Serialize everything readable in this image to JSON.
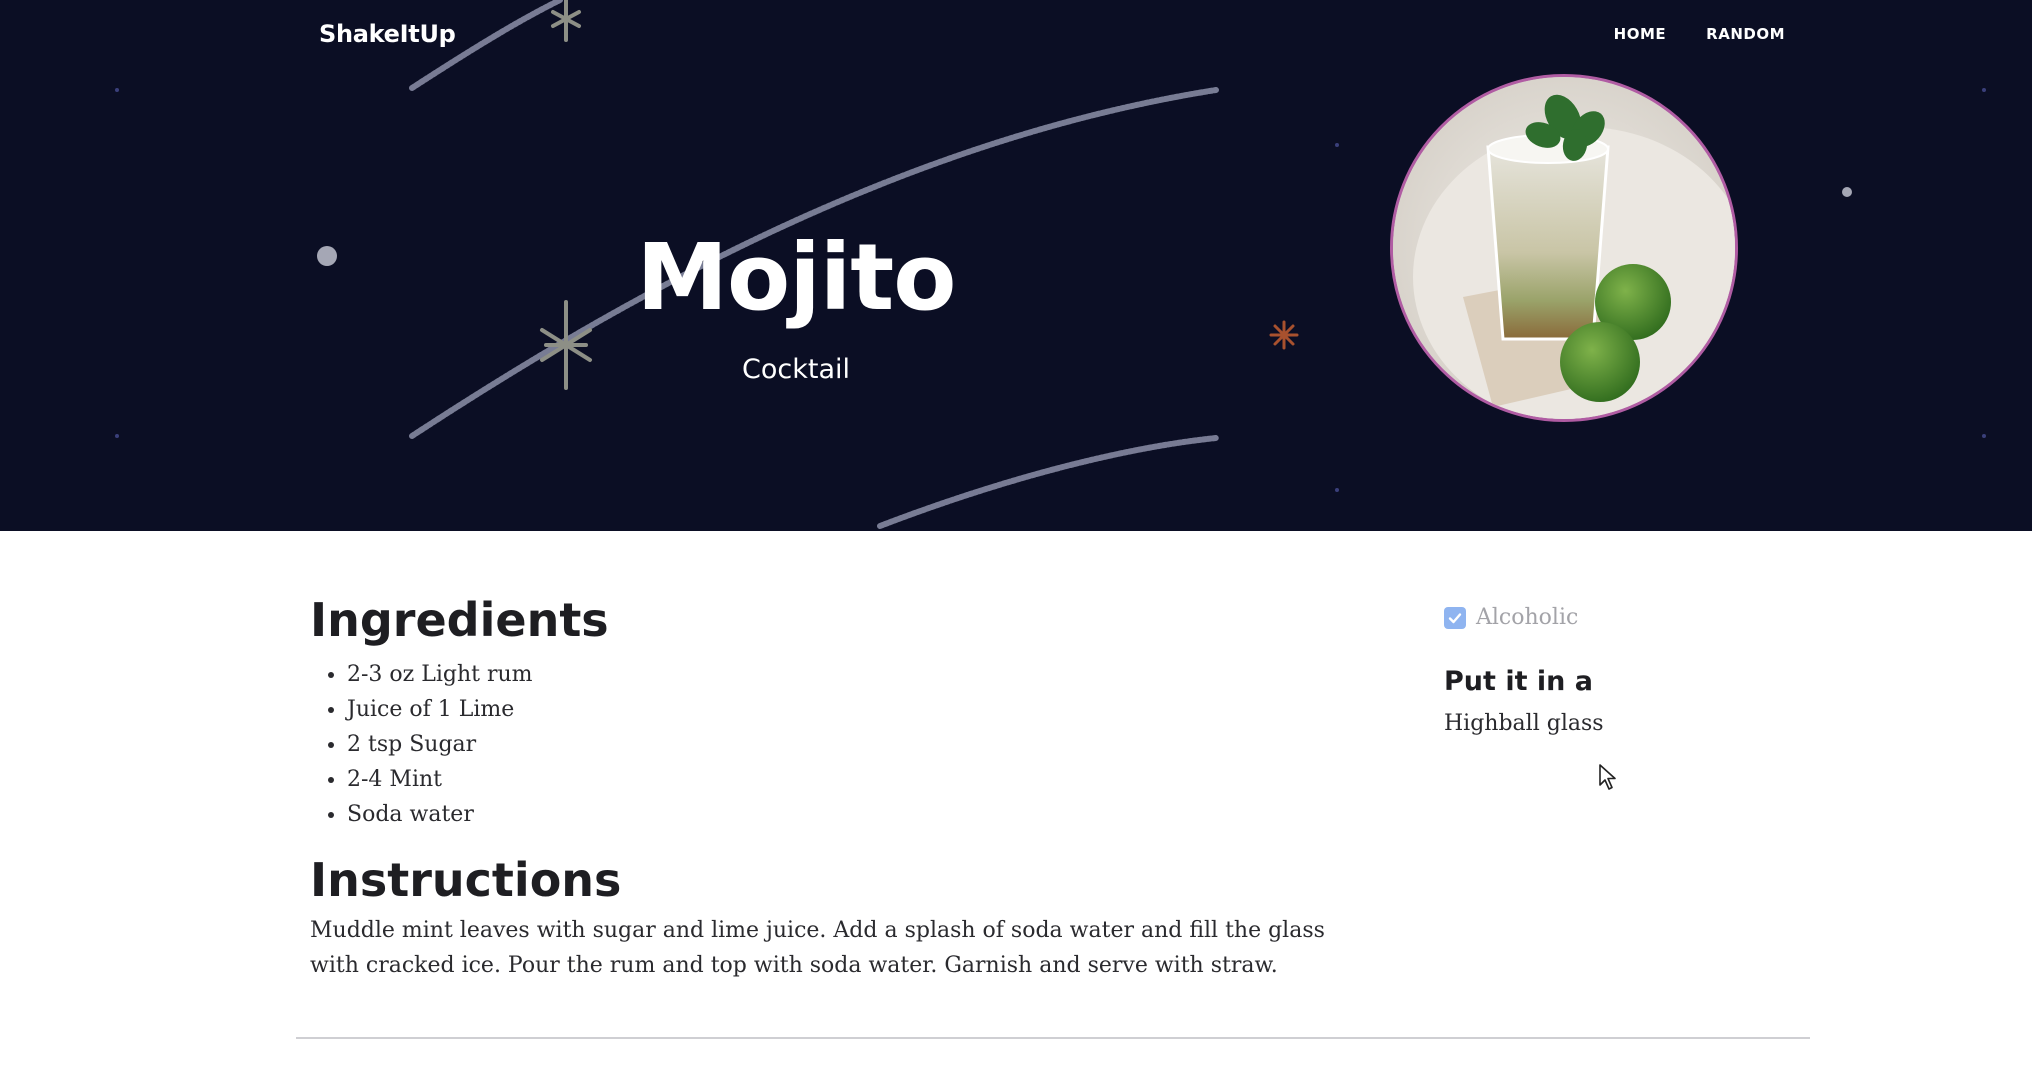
{
  "nav": {
    "brand": "ShakeItUp",
    "links": [
      "HOME",
      "RANDOM"
    ]
  },
  "hero": {
    "title": "Mojito",
    "subtitle": "Cocktail",
    "background_color": "#0b0e24",
    "photo_border_color": "#b05ca3"
  },
  "ingredients": {
    "heading": "Ingredients",
    "items": [
      "2-3 oz Light rum",
      "Juice of 1 Lime",
      "2 tsp Sugar",
      "2-4 Mint",
      "Soda water"
    ]
  },
  "instructions": {
    "heading": "Instructions",
    "text": "Muddle mint leaves with sugar and lime juice. Add a splash of soda water and fill the glass with cracked ice. Pour the rum and top with soda water. Garnish and serve with straw."
  },
  "details": {
    "alcoholic_label": "Alcoholic",
    "alcoholic_checked": true,
    "glass_heading": "Put it in a",
    "glass_value": "Highball glass"
  },
  "icons": [
    "checkmark-icon",
    "mouse-cursor-icon"
  ]
}
